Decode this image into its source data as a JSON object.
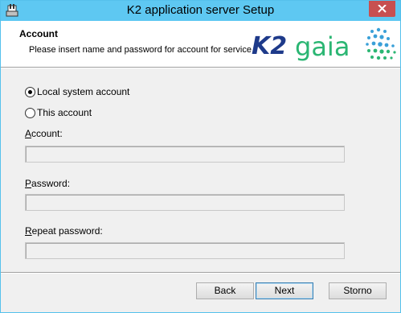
{
  "window": {
    "title": "K2 application server Setup"
  },
  "header": {
    "title": "Account",
    "description": "Please insert name and password for account for service",
    "logo_text": "K2 gaia"
  },
  "options": [
    {
      "label": "Local system account",
      "selected": true
    },
    {
      "label": "This account",
      "selected": false
    }
  ],
  "fields": {
    "account": {
      "label_mnemonic": "A",
      "label_rest": "ccount:",
      "value": ""
    },
    "password": {
      "label_mnemonic": "P",
      "label_rest": "assword:",
      "value": ""
    },
    "repeat_password": {
      "label_mnemonic": "R",
      "label_rest": "epeat password:",
      "value": ""
    }
  },
  "buttons": {
    "back": "Back",
    "next": "Next",
    "cancel": "Storno"
  },
  "colors": {
    "titlebar": "#5ec8f2",
    "close": "#c75050",
    "k2_blue": "#1e3a8a",
    "gaia_green": "#2bb673"
  },
  "icons": {
    "app": "installer-icon",
    "close": "close-icon"
  }
}
